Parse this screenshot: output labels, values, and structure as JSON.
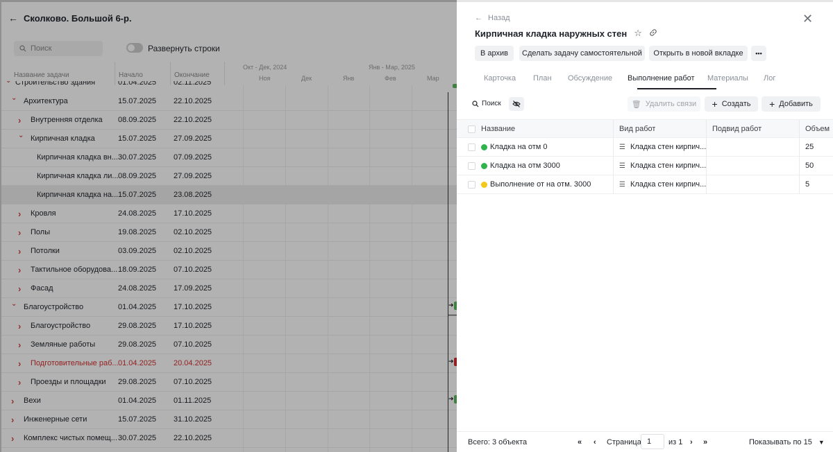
{
  "background": {
    "project_title": "Сколково. Большой 6-р.",
    "search_placeholder": "Поиск",
    "expand_rows_label": "Развернуть строки",
    "columns": {
      "name": "Название задачи",
      "start": "Начало",
      "end": "Окончание"
    },
    "timeline": {
      "quarters": [
        "Окт - Дек, 2024",
        "Янв - Мар, 2025"
      ],
      "months": [
        "Ноя",
        "Дек",
        "Янв",
        "Фев",
        "Мар"
      ]
    },
    "partial_row": {
      "name": "Строительство здания",
      "start": "01.04.2025",
      "end": "02.11.2025"
    },
    "rows": [
      {
        "name": "Архитектура",
        "start": "15.07.2025",
        "end": "22.10.2025",
        "level": 1,
        "chev": "down"
      },
      {
        "name": "Внутренняя отделка",
        "start": "08.09.2025",
        "end": "22.10.2025",
        "level": 2,
        "chev": "right"
      },
      {
        "name": "Кирпичная кладка",
        "start": "15.07.2025",
        "end": "27.09.2025",
        "level": 2,
        "chev": "down"
      },
      {
        "name": "Кирпичная кладка вн...",
        "start": "30.07.2025",
        "end": "07.09.2025",
        "level": 3,
        "chev": ""
      },
      {
        "name": "Кирпичная кладка ли...",
        "start": "08.09.2025",
        "end": "27.09.2025",
        "level": 3,
        "chev": ""
      },
      {
        "name": "Кирпичная кладка на...",
        "start": "15.07.2025",
        "end": "23.08.2025",
        "level": 3,
        "chev": "",
        "selected": true
      },
      {
        "name": "Кровля",
        "start": "24.08.2025",
        "end": "17.10.2025",
        "level": 2,
        "chev": "right"
      },
      {
        "name": "Полы",
        "start": "19.08.2025",
        "end": "02.10.2025",
        "level": 2,
        "chev": "right"
      },
      {
        "name": "Потолки",
        "start": "03.09.2025",
        "end": "02.10.2025",
        "level": 2,
        "chev": "right"
      },
      {
        "name": "Тактильное оборудова...",
        "start": "18.09.2025",
        "end": "07.10.2025",
        "level": 2,
        "chev": "right"
      },
      {
        "name": "Фасад",
        "start": "24.08.2025",
        "end": "17.09.2025",
        "level": 2,
        "chev": "right"
      },
      {
        "name": "Благоустройство",
        "start": "01.04.2025",
        "end": "17.10.2025",
        "level": 1,
        "chev": "down"
      },
      {
        "name": "Благоустройство",
        "start": "29.08.2025",
        "end": "17.10.2025",
        "level": 2,
        "chev": "right"
      },
      {
        "name": "Земляные работы",
        "start": "29.08.2025",
        "end": "07.10.2025",
        "level": 2,
        "chev": "right"
      },
      {
        "name": "Подготовительные раб...",
        "start": "01.04.2025",
        "end": "20.04.2025",
        "level": 2,
        "chev": "right",
        "red": true
      },
      {
        "name": "Проезды и площадки",
        "start": "29.08.2025",
        "end": "07.10.2025",
        "level": 2,
        "chev": "right"
      },
      {
        "name": "Вехи",
        "start": "01.04.2025",
        "end": "01.11.2025",
        "level": 1,
        "chev": "right"
      },
      {
        "name": "Инженерные сети",
        "start": "15.07.2025",
        "end": "31.10.2025",
        "level": 1,
        "chev": "right"
      },
      {
        "name": "Комплекс чистых помещ...",
        "start": "30.07.2025",
        "end": "22.10.2025",
        "level": 1,
        "chev": "right"
      }
    ]
  },
  "panel": {
    "back_label": "Назад",
    "title": "Кирпичная кладка наружных стен",
    "actions": [
      "В архив",
      "Сделать задачу самостоятельной",
      "Открыть в новой вкладке",
      "•••"
    ],
    "tabs": [
      "Карточка",
      "План",
      "Обсуждение",
      "Выполнение работ",
      "Материалы",
      "Лог"
    ],
    "active_tab": "Выполнение работ",
    "toolbar": {
      "search_label": "Поиск",
      "delete_links_label": "Удалить связи",
      "create_label": "Создать",
      "add_label": "Добавить"
    },
    "table": {
      "headers": {
        "name": "Название",
        "work_type": "Вид работ",
        "work_subtype": "Подвид работ",
        "volume": "Объем"
      },
      "rows": [
        {
          "name": "Кладка на отм 0",
          "status_color": "#2fb34a",
          "work_type": "Кладка стен кирпич...",
          "work_subtype": "",
          "volume": "25"
        },
        {
          "name": "Кладка на отм 3000",
          "status_color": "#2fb34a",
          "work_type": "Кладка стен кирпич...",
          "work_subtype": "",
          "volume": "50"
        },
        {
          "name": "Выполнение от на отм. 3000",
          "status_color": "#f2c81d",
          "work_type": "Кладка стен кирпич...",
          "work_subtype": "",
          "volume": "5"
        }
      ]
    },
    "footer": {
      "total": "Всего: 3 объекта",
      "page_label": "Страница",
      "page_value": "1",
      "of_label": "из 1",
      "per_page": "Показывать по 15"
    }
  }
}
